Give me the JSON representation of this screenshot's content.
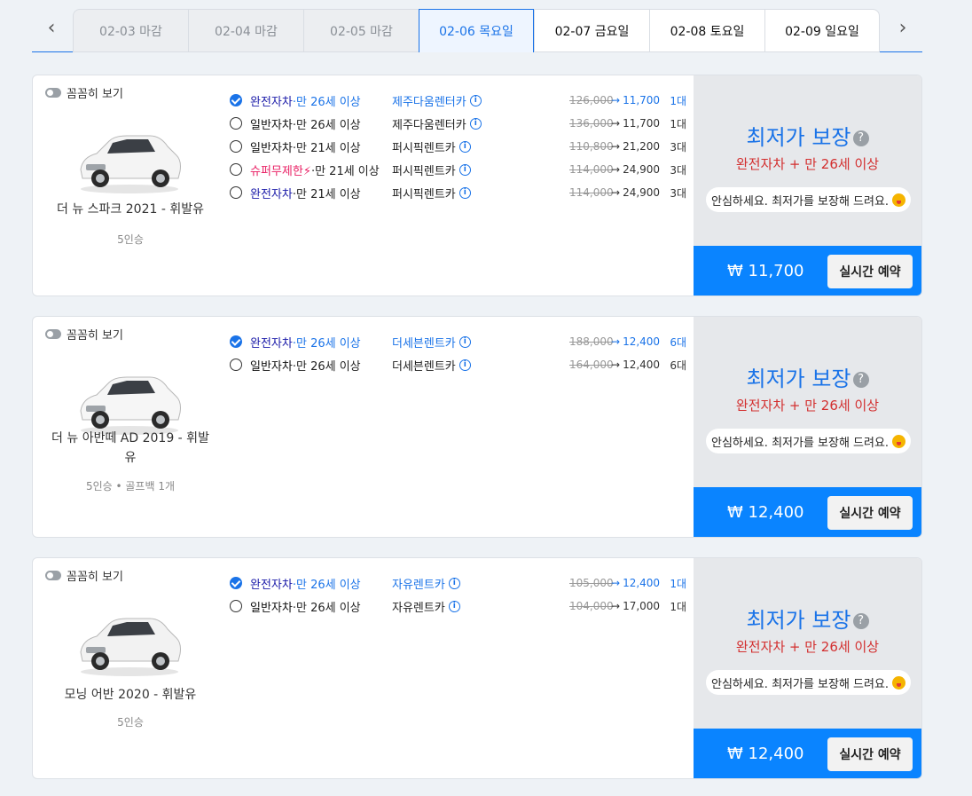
{
  "date_tabs": [
    {
      "label": "02-03 마감",
      "state": "closed"
    },
    {
      "label": "02-04 마감",
      "state": "closed"
    },
    {
      "label": "02-05 마감",
      "state": "closed"
    },
    {
      "label": "02-06 목요일",
      "state": "active"
    },
    {
      "label": "02-07 금요일",
      "state": "open"
    },
    {
      "label": "02-08 토요일",
      "state": "open"
    },
    {
      "label": "02-09 일요일",
      "state": "open"
    }
  ],
  "nav": {
    "prev": "‹",
    "next": "›"
  },
  "cards": [
    {
      "toggle_label": "꼼꼼히 보기",
      "car_name": "더 뉴 스파크 2021 - 휘발유",
      "car_meta": "5인승",
      "car_color": "#f4f4f4",
      "options": [
        {
          "coverage": "완전자차",
          "age": "·만 26세 이상",
          "company": "제주다움렌터카",
          "orig": "126,000",
          "final": "11,700",
          "count": "1대",
          "selected": true
        },
        {
          "coverage": "일반자차",
          "age": "·만 26세 이상",
          "company": "제주다움렌터카",
          "orig": "136,000",
          "final": "11,700",
          "count": "1대",
          "selected": false
        },
        {
          "coverage": "일반자차",
          "age": "·만 21세 이상",
          "company": "퍼시픽렌트카",
          "orig": "110,800",
          "final": "21,200",
          "count": "3대",
          "selected": false
        },
        {
          "coverage": "슈퍼무제한",
          "age": "·만 21세 이상",
          "company": "퍼시픽렌트카",
          "orig": "114,000",
          "final": "24,900",
          "count": "3대",
          "selected": false,
          "super": true
        },
        {
          "coverage": "완전자차",
          "age": "·만 21세 이상",
          "company": "퍼시픽렌트카",
          "orig": "114,000",
          "final": "24,900",
          "count": "3대",
          "selected": false,
          "navy": true
        }
      ],
      "guarantee": "최저가 보장",
      "condition": "완전자차 + 만 26세 이상",
      "assure": "안심하세요. 최저가를 보장해 드려요.",
      "price": "₩ 11,700",
      "book_label": "실시간 예약"
    },
    {
      "toggle_label": "꼼꼼히 보기",
      "car_name": "더 뉴 아반떼 AD 2019 - 휘발유",
      "car_meta": "5인승 • 골프백 1개",
      "car_color": "#f6f6f6",
      "options": [
        {
          "coverage": "완전자차",
          "age": "·만 26세 이상",
          "company": "더세븐렌트카",
          "orig": "188,000",
          "final": "12,400",
          "count": "6대",
          "selected": true
        },
        {
          "coverage": "일반자차",
          "age": "·만 26세 이상",
          "company": "더세븐렌트카",
          "orig": "164,000",
          "final": "12,400",
          "count": "6대",
          "selected": false
        }
      ],
      "guarantee": "최저가 보장",
      "condition": "완전자차 + 만 26세 이상",
      "assure": "안심하세요. 최저가를 보장해 드려요.",
      "price": "₩ 12,400",
      "book_label": "실시간 예약"
    },
    {
      "toggle_label": "꼼꼼히 보기",
      "car_name": "모닝 어반 2020 - 휘발유",
      "car_meta": "5인승",
      "car_color": "#f2f2f2",
      "options": [
        {
          "coverage": "완전자차",
          "age": "·만 26세 이상",
          "company": "자유렌트카",
          "orig": "105,000",
          "final": "12,400",
          "count": "1대",
          "selected": true
        },
        {
          "coverage": "일반자차",
          "age": "·만 26세 이상",
          "company": "자유렌트카",
          "orig": "104,000",
          "final": "17,000",
          "count": "1대",
          "selected": false
        }
      ],
      "guarantee": "최저가 보장",
      "condition": "완전자차 + 만 26세 이상",
      "assure": "안심하세요. 최저가를 보장해 드려요.",
      "price": "₩ 12,400",
      "book_label": "실시간 예약"
    }
  ]
}
